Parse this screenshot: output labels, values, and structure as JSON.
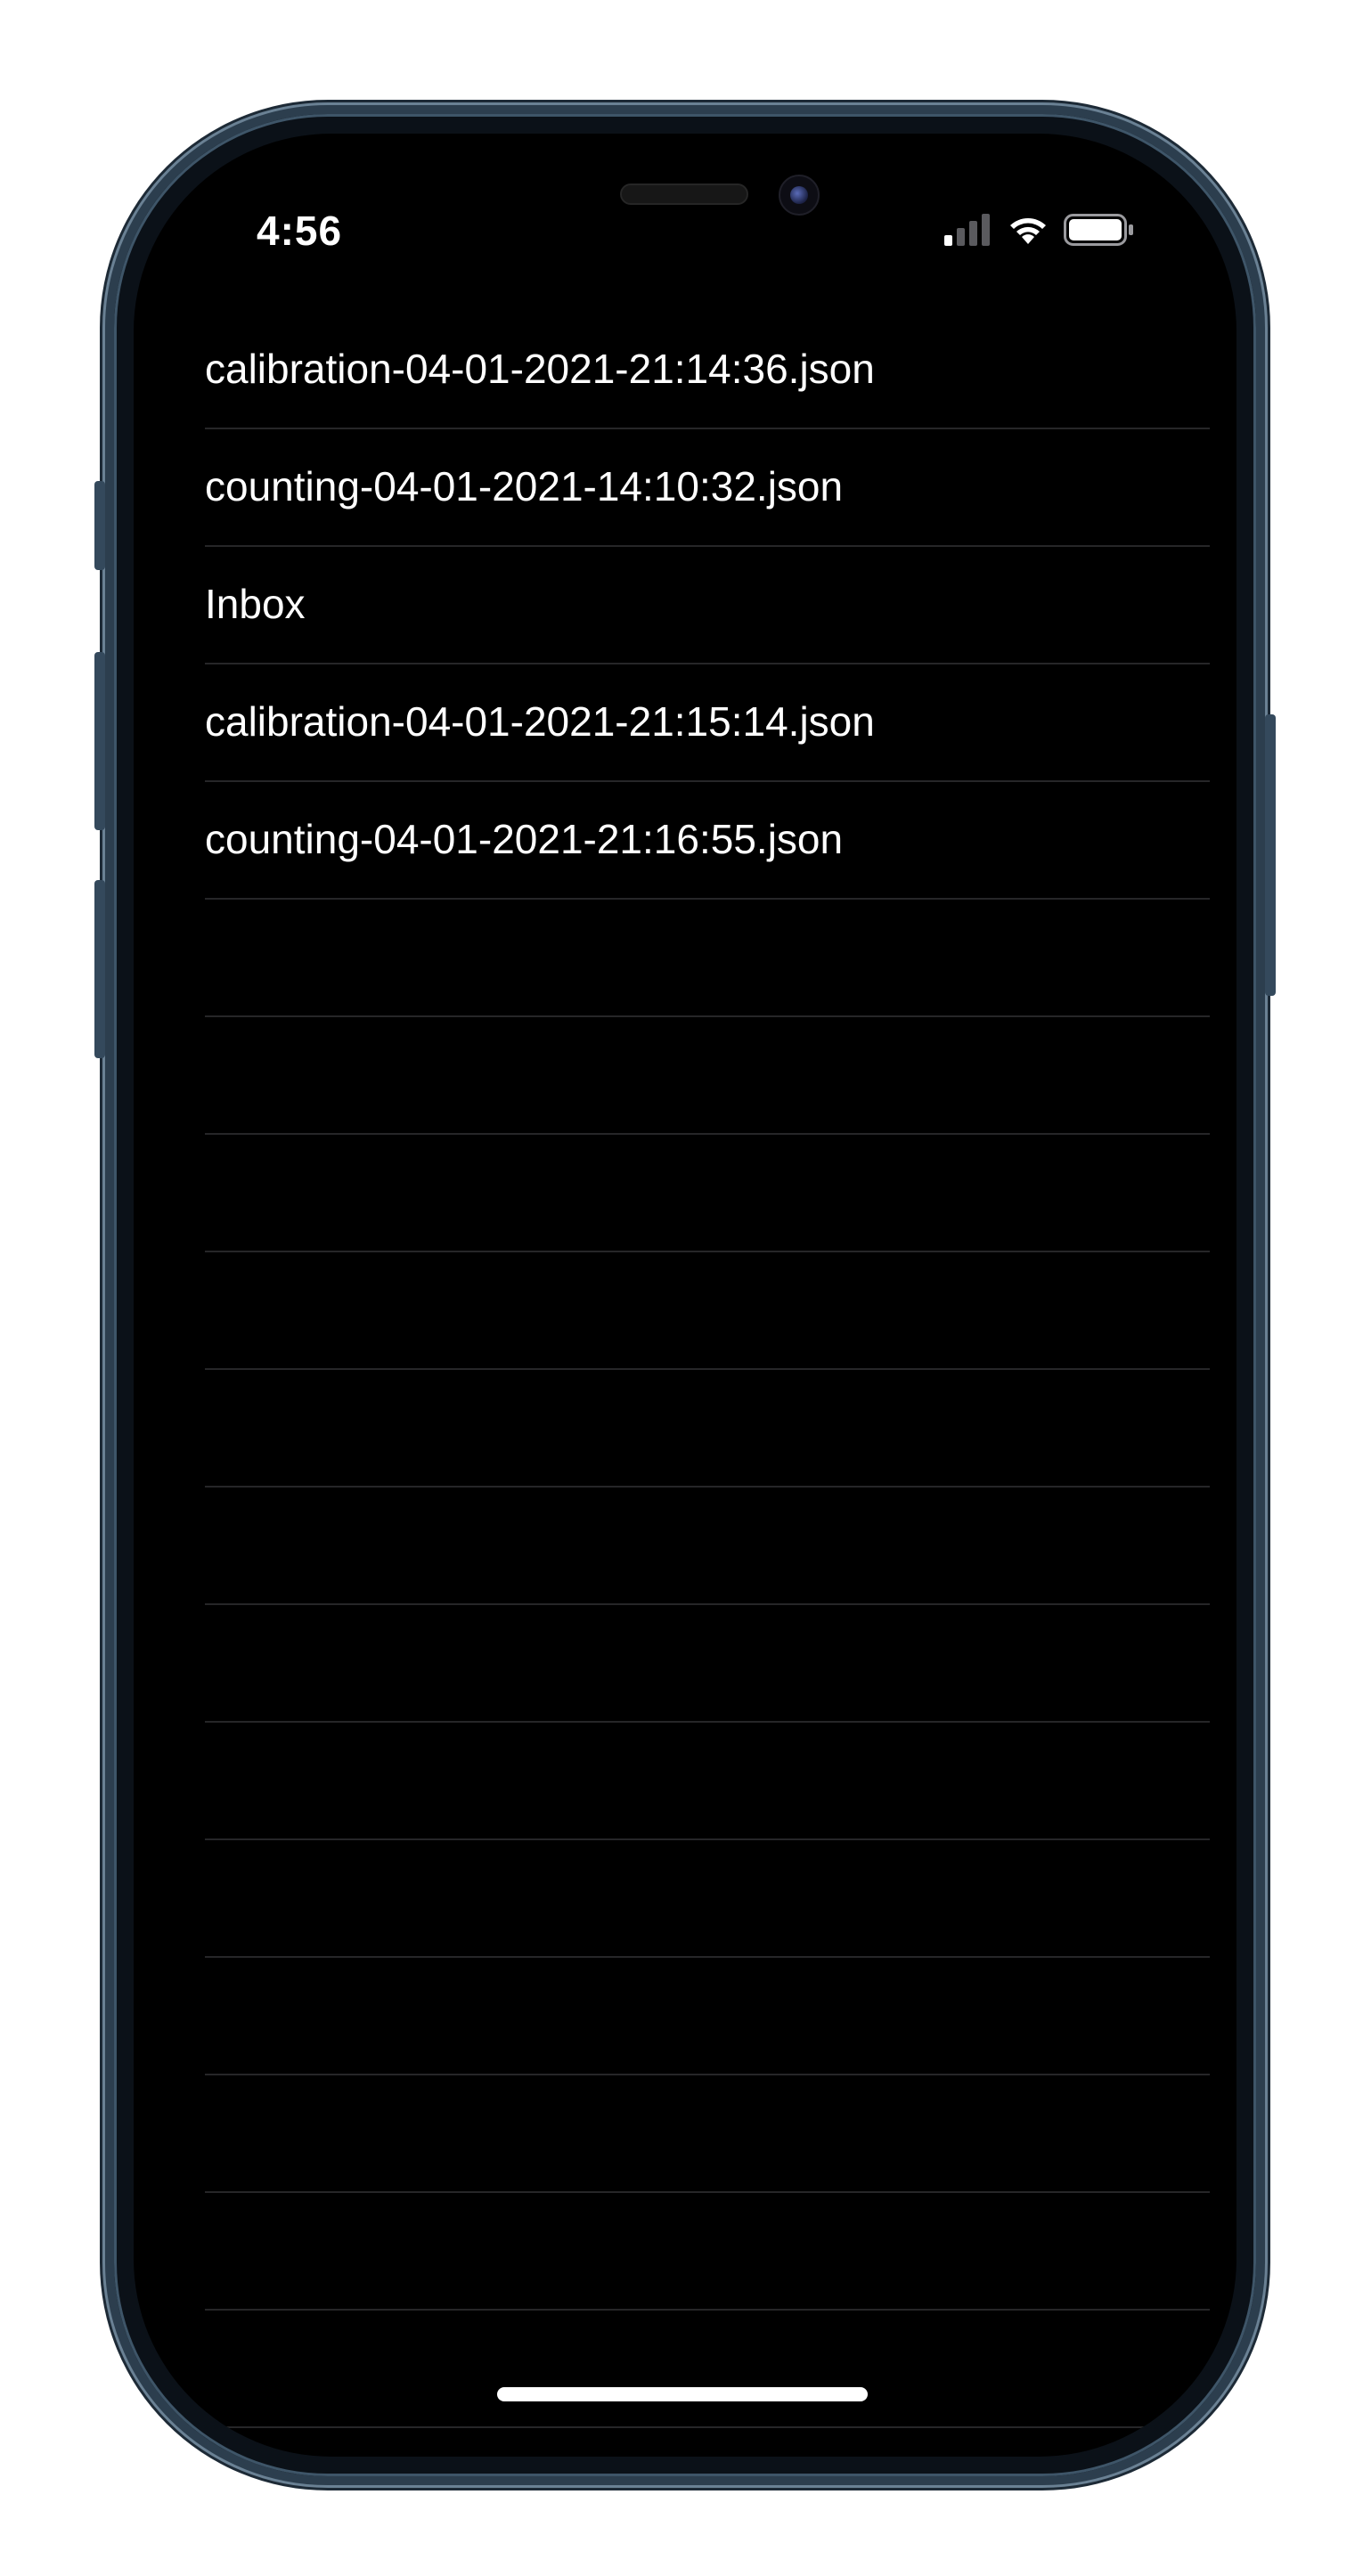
{
  "status_bar": {
    "time": "4:56",
    "signal_icon": "cellular-signal-icon",
    "wifi_icon": "wifi-icon",
    "battery_icon": "battery-icon"
  },
  "files": {
    "items": [
      {
        "label": "calibration-04-01-2021-21:14:36.json"
      },
      {
        "label": "counting-04-01-2021-14:10:32.json"
      },
      {
        "label": "Inbox"
      },
      {
        "label": "calibration-04-01-2021-21:15:14.json"
      },
      {
        "label": "counting-04-01-2021-21:16:55.json"
      }
    ],
    "empty_row_count": 13
  }
}
